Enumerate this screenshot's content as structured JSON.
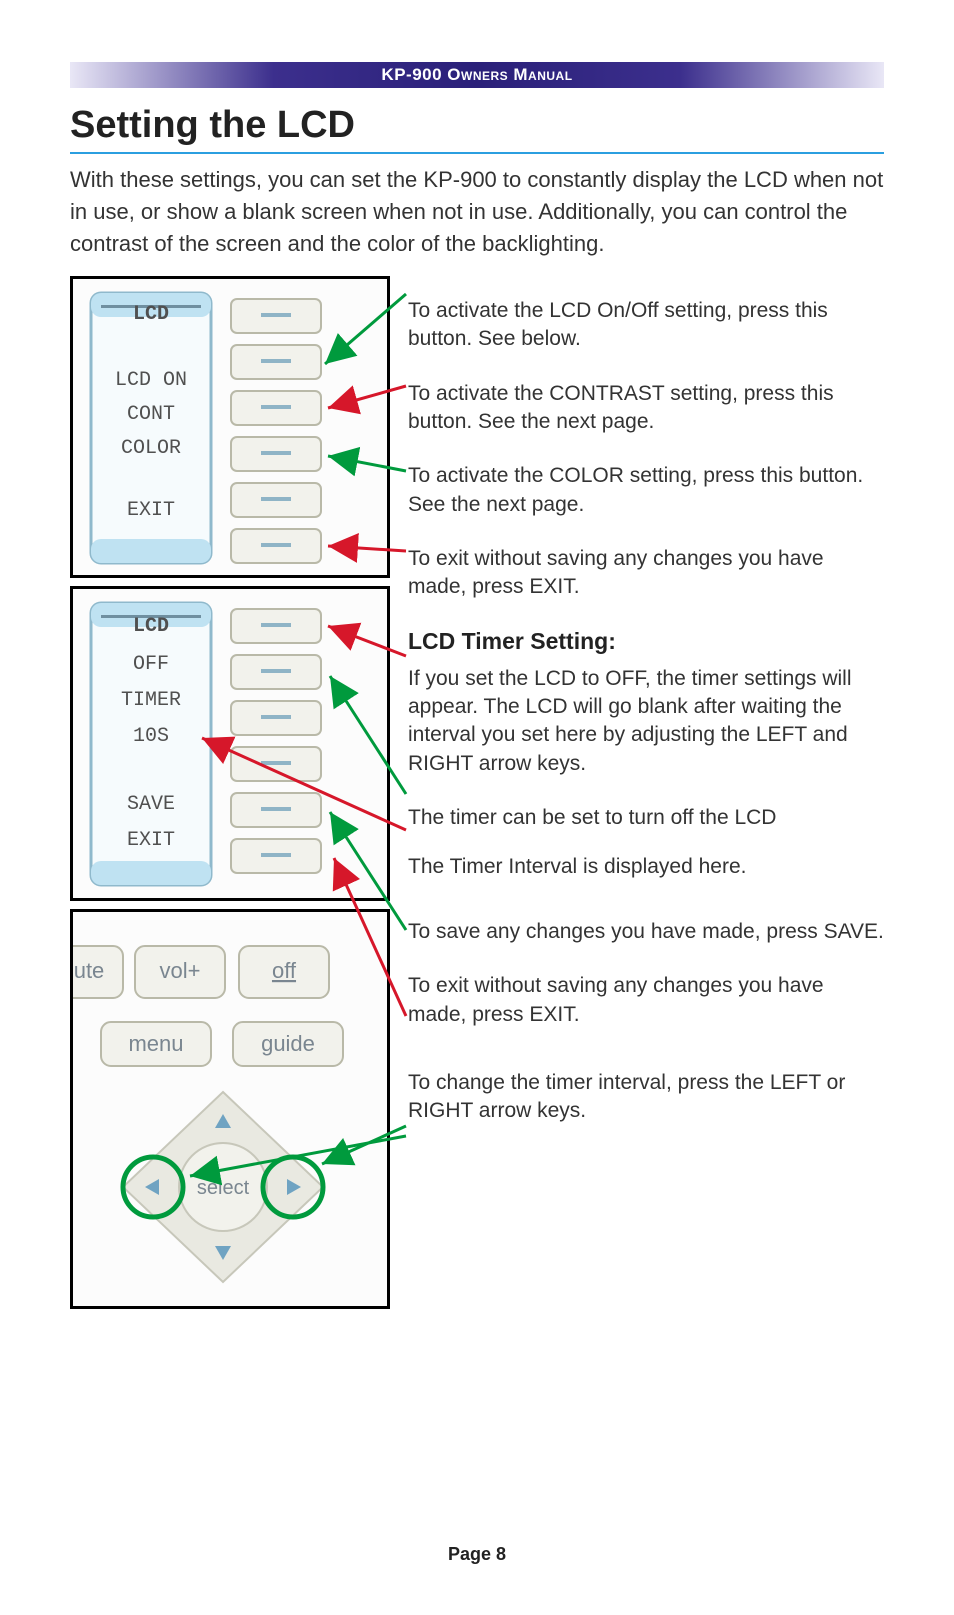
{
  "header": {
    "title": "KP-900 Owners Manual"
  },
  "heading": "Setting the LCD",
  "intro": "With these settings, you can set the KP-900 to constantly display the LCD when not in use, or show a blank screen when not in use. Additionally, you can control the contrast of the screen and the color of the backlighting.",
  "panel1": {
    "title": "LCD",
    "items": [
      "LCD ON",
      "CONT",
      "COLOR",
      "EXIT"
    ]
  },
  "panel2": {
    "title": "LCD",
    "items": [
      "OFF",
      "TIMER",
      "10S",
      "SAVE",
      "EXIT"
    ]
  },
  "panel3": {
    "buttons": {
      "mute_frag": "ute",
      "volup": "vol+",
      "off": "off",
      "menu": "menu",
      "guide": "guide",
      "select": "select"
    }
  },
  "callouts": {
    "c1": "To activate the LCD On/Off setting, press this button. See below.",
    "c2": "To activate the CONTRAST setting, press this button. See the next page.",
    "c3": "To activate the COLOR setting, press this button. See the next page.",
    "c4": "To exit without saving any changes you have made, press EXIT.",
    "sub": "LCD Timer Setting:",
    "c5": "If you set the LCD to OFF, the timer settings will appear. The LCD will go blank after waiting the interval you set here by adjusting the LEFT and RIGHT arrow keys.",
    "c6": "The timer can be set to turn off the LCD",
    "c7": "The Timer Interval is displayed here.",
    "c8": "To save any changes you have made, press SAVE.",
    "c9": "To exit without saving any changes you have made, press EXIT.",
    "c10": "To change the timer interval, press the LEFT or RIGHT arrow keys."
  },
  "footer": {
    "page": "Page 8"
  },
  "colors": {
    "arrow_green": "#009a3d",
    "arrow_red": "#d6172a",
    "rule": "#2b9fe0"
  }
}
